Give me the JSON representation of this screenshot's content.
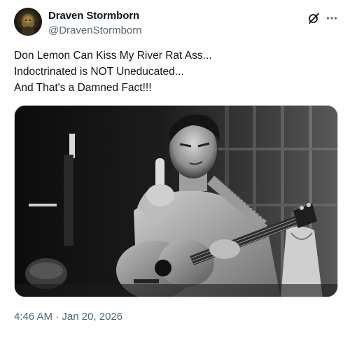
{
  "author": {
    "name": "Draven Stormborn",
    "handle": "@DravenStormborn",
    "avatar_icon": "profile-avatar"
  },
  "actions": {
    "grok_icon": "grok-icon",
    "more_icon": "more-horizontal-icon"
  },
  "post": {
    "lines": [
      "Don Lemon Can Kiss My River Rat Ass...",
      "Indoctrinated is NOT Uneducated...",
      "And That's a Damned Fact!!!"
    ]
  },
  "media": {
    "kind": "black-and-white photo"
  },
  "timestamp": {
    "time": "4:46 AM",
    "separator": "·",
    "date": "Jan 20, 2026"
  },
  "colors": {
    "text_primary": "#0f1419",
    "text_secondary": "#536471",
    "border": "#cfd9de"
  }
}
